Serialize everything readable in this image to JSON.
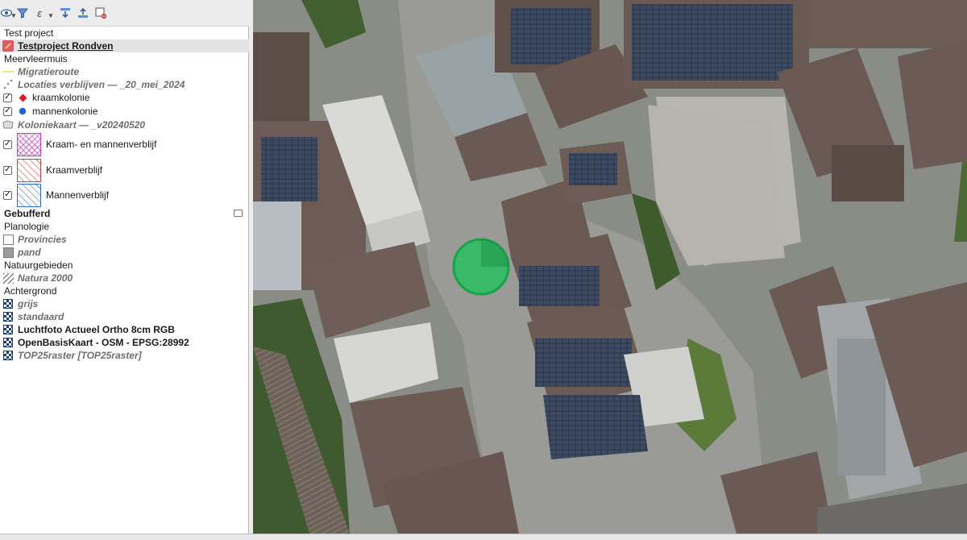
{
  "toolbar": {
    "icons": [
      "eye-icon",
      "filter-icon",
      "expression-filter-icon",
      "expand-all-icon",
      "collapse-all-icon",
      "remove-layer-icon"
    ]
  },
  "tree": {
    "project": "Test project",
    "group_main": "Testproject Rondven",
    "meervleermuis": "Meervleermuis",
    "migratieroute": "Migratieroute",
    "locaties": "Locaties verblijven — _20_mei_2024",
    "kraamkolonie": "kraamkolonie",
    "mannenkolonie": "mannenkolonie",
    "koloniekaart": "Koloniekaart — _v20240520",
    "kraam_mannen": "Kraam- en mannenverblijf",
    "kraamverblijf": "Kraamverblijf",
    "mannenverblijf": "Mannenverblijf",
    "gebufferd": "Gebufferd",
    "planologie": "Planologie",
    "provincies": "Provincies",
    "pand": "pand",
    "natuurgebieden": "Natuurgebieden",
    "natura2000": "Natura 2000",
    "achtergrond": "Achtergrond",
    "grijs": "grijs",
    "standaard": "standaard",
    "luchtfoto": "Luchtfoto Actueel Ortho 8cm RGB",
    "openbasiskaart": "OpenBasisKaart - OSM - EPSG:28992",
    "top25": "TOP25raster [TOP25raster]",
    "check": "✓"
  },
  "colors": {
    "kraamkolonie": "#e8141c",
    "mannenkolonie": "#1f5fe0",
    "migratieroute": "#f2e27a",
    "buffer_fill": "#22c25a",
    "group_icon": "#e0576a"
  }
}
